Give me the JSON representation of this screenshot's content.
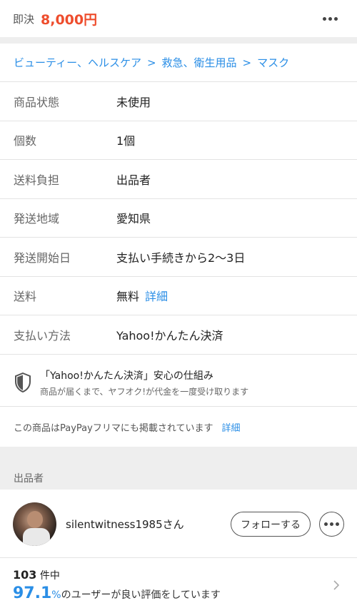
{
  "header": {
    "buy_now_label": "即決",
    "price": "8,000円"
  },
  "breadcrumb": {
    "items": [
      "ビューティー、ヘルスケア",
      "救急、衛生用品",
      "マスク"
    ],
    "separator": ">"
  },
  "details": [
    {
      "key": "商品状態",
      "value": "未使用"
    },
    {
      "key": "個数",
      "value": "1個"
    },
    {
      "key": "送料負担",
      "value": "出品者"
    },
    {
      "key": "発送地域",
      "value": "愛知県"
    },
    {
      "key": "発送開始日",
      "value": "支払い手続きから2〜3日"
    },
    {
      "key": "送料",
      "value": "無料",
      "link": "詳細"
    },
    {
      "key": "支払い方法",
      "value": "Yahoo!かんたん決済"
    }
  ],
  "secure": {
    "title": "「Yahoo!かんたん決済」安心の仕組み",
    "subtitle": "商品が届くまで、ヤフオク!が代金を一度受け取ります"
  },
  "paypay": {
    "text": "この商品はPayPayフリマにも掲載されています",
    "link": "詳細"
  },
  "seller_section": {
    "heading": "出品者"
  },
  "seller": {
    "name": "silentwitness1985さん",
    "follow_label": "フォローする"
  },
  "rating": {
    "count": "103",
    "count_suffix": "件中",
    "percent": "97.1",
    "percent_unit": "%",
    "rating_text": "のユーザーが良い評価をしています"
  },
  "icons": {
    "more": "more-horizontal-icon",
    "shield": "shield-icon",
    "chevron": "chevron-right-icon"
  },
  "colors": {
    "price": "#ee4d2d",
    "link": "#2a8ee6"
  }
}
